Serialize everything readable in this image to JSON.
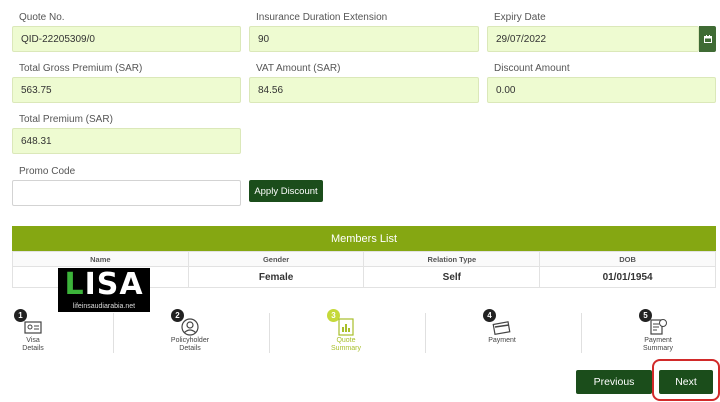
{
  "fields": {
    "quote_no": {
      "label": "Quote No.",
      "value": "QID-22205309/0"
    },
    "insurance_duration": {
      "label": "Insurance Duration Extension",
      "value": "90"
    },
    "expiry_date": {
      "label": "Expiry Date",
      "value": "29/07/2022"
    },
    "total_gross_premium": {
      "label": "Total Gross Premium (SAR)",
      "value": "563.75"
    },
    "vat_amount": {
      "label": "VAT Amount (SAR)",
      "value": "84.56"
    },
    "discount_amount": {
      "label": "Discount Amount",
      "value": "0.00"
    },
    "total_premium": {
      "label": "Total Premium (SAR)",
      "value": "648.31"
    },
    "promo_code": {
      "label": "Promo Code",
      "value": ""
    }
  },
  "apply_discount_label": "Apply Discount",
  "members": {
    "title": "Members List",
    "columns": [
      "Name",
      "Gender",
      "Relation Type",
      "DOB"
    ],
    "rows": [
      {
        "name": "",
        "gender": "Female",
        "relation": "Self",
        "dob": "01/01/1954"
      }
    ]
  },
  "watermark": {
    "text": "LISA",
    "url": "lifeinsaudiarabia.net"
  },
  "steps": [
    {
      "num": "1",
      "label_line1": "Visa",
      "label_line2": "Details",
      "icon": "visa-card-icon",
      "active": false
    },
    {
      "num": "2",
      "label_line1": "Policyholder",
      "label_line2": "Details",
      "icon": "person-icon",
      "active": false
    },
    {
      "num": "3",
      "label_line1": "Quote",
      "label_line2": "Summary",
      "icon": "chart-document-icon",
      "active": true
    },
    {
      "num": "4",
      "label_line1": "Payment",
      "label_line2": "",
      "icon": "payment-card-icon",
      "active": false
    },
    {
      "num": "5",
      "label_line1": "Payment",
      "label_line2": "Summary",
      "icon": "receipt-icon",
      "active": false
    }
  ],
  "nav": {
    "previous_label": "Previous",
    "next_label": "Next"
  },
  "colors": {
    "accent": "#85a712",
    "button": "#1b4d1b",
    "input_bg": "#eefbd1",
    "highlight": "#d12a2a"
  }
}
